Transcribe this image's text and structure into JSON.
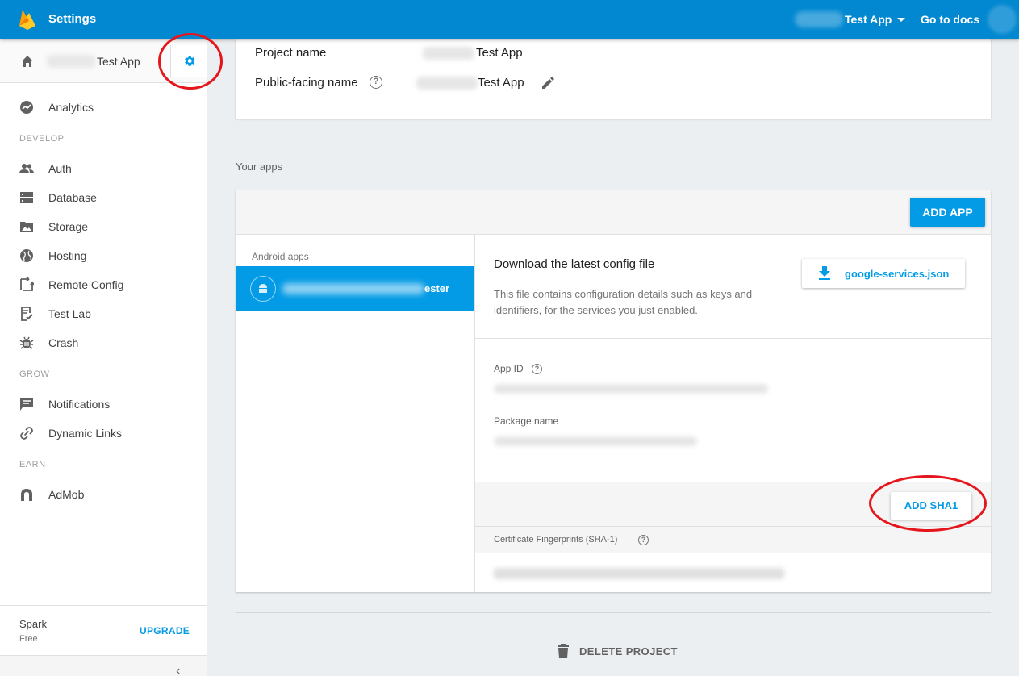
{
  "topbar": {
    "title": "Settings",
    "project_label": "Test App",
    "docs_link": "Go to docs",
    "brand_color": "#0288d1"
  },
  "sidebar": {
    "project_name": "Test App",
    "nav": [
      {
        "label": "Analytics",
        "icon": "analytics-icon"
      }
    ],
    "sections": {
      "develop": "DEVELOP",
      "grow": "GROW",
      "earn": "EARN"
    },
    "develop_items": [
      {
        "label": "Auth",
        "icon": "people-icon"
      },
      {
        "label": "Database",
        "icon": "database-icon"
      },
      {
        "label": "Storage",
        "icon": "image-icon"
      },
      {
        "label": "Hosting",
        "icon": "globe-icon"
      },
      {
        "label": "Remote Config",
        "icon": "remote-config-icon"
      },
      {
        "label": "Test Lab",
        "icon": "checklist-icon"
      },
      {
        "label": "Crash",
        "icon": "bug-icon"
      }
    ],
    "grow_items": [
      {
        "label": "Notifications",
        "icon": "message-icon"
      },
      {
        "label": "Dynamic Links",
        "icon": "link-icon"
      }
    ],
    "earn_items": [
      {
        "label": "AdMob",
        "icon": "admob-icon"
      }
    ],
    "plan": "Spark",
    "plan_tier": "Free",
    "upgrade": "UPGRADE",
    "collapse": "‹"
  },
  "project": {
    "name_label": "Project name",
    "name_value": "Test App",
    "public_label": "Public-facing name",
    "public_value": "Test App",
    "help": "?"
  },
  "apps": {
    "heading": "Your apps",
    "add_app": "ADD APP",
    "android_section": "Android apps",
    "app_name_suffix": "ester",
    "config_title": "Download the latest config file",
    "config_desc": "This file contains configuration details such as keys and identifiers, for the services you just enabled.",
    "config_file": "google-services.json",
    "app_id_label": "App ID",
    "package_label": "Package name",
    "add_sha1": "ADD SHA1",
    "cert_label": "Certificate Fingerprints (SHA-1)"
  },
  "danger": {
    "delete": "DELETE PROJECT"
  },
  "colors": {
    "accent": "#039be5",
    "annotation": "#e4161c"
  }
}
